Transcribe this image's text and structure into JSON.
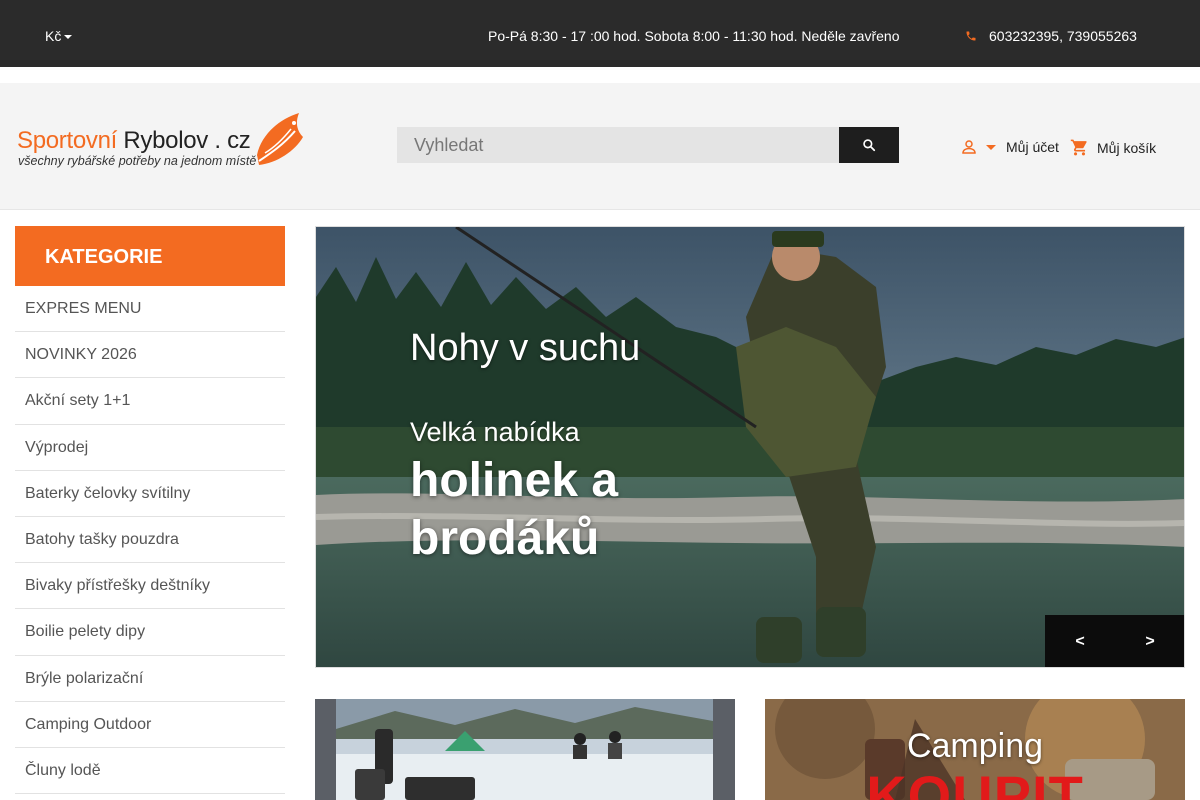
{
  "topbar": {
    "currency": "Kč",
    "hours": "Po-Pá 8:30 - 17 :00 hod. Sobota 8:00 - 11:30 hod. Neděle zavřeno",
    "phone": "603232395, 739055263"
  },
  "logo": {
    "part1": "Sportovní",
    "part2": " Rybolov . cz",
    "tagline": "všechny rybářské potřeby na jednom místě"
  },
  "search": {
    "placeholder": "Vyhledat"
  },
  "account": {
    "label": "Můj účet"
  },
  "cart": {
    "label": "Můj košík"
  },
  "sidebar": {
    "title": "KATEGORIE",
    "items": [
      {
        "label": "EXPRES MENU"
      },
      {
        "label": "NOVINKY 2026"
      },
      {
        "label": "Akční sety 1+1"
      },
      {
        "label": "Výprodej"
      },
      {
        "label": "Baterky čelovky svítilny"
      },
      {
        "label": "Batohy tašky pouzdra"
      },
      {
        "label": "Bivaky přístřešky deštníky"
      },
      {
        "label": "Boilie pelety dipy"
      },
      {
        "label": "Brýle polarizační"
      },
      {
        "label": "Camping Outdoor"
      },
      {
        "label": "Čluny lodě"
      }
    ]
  },
  "hero": {
    "line1": "Nohy v suchu",
    "line2": "Velká nabídka",
    "line3": "holinek a brodáků",
    "prev": "<",
    "next": ">"
  },
  "tiles": {
    "right_label": "Camping",
    "right_big": "KOUPIT"
  },
  "colors": {
    "accent": "#f36b21",
    "topbar_bg": "#2b2b2b",
    "header_bg": "#f4f4f4",
    "dark_button": "#1e1e1e"
  }
}
